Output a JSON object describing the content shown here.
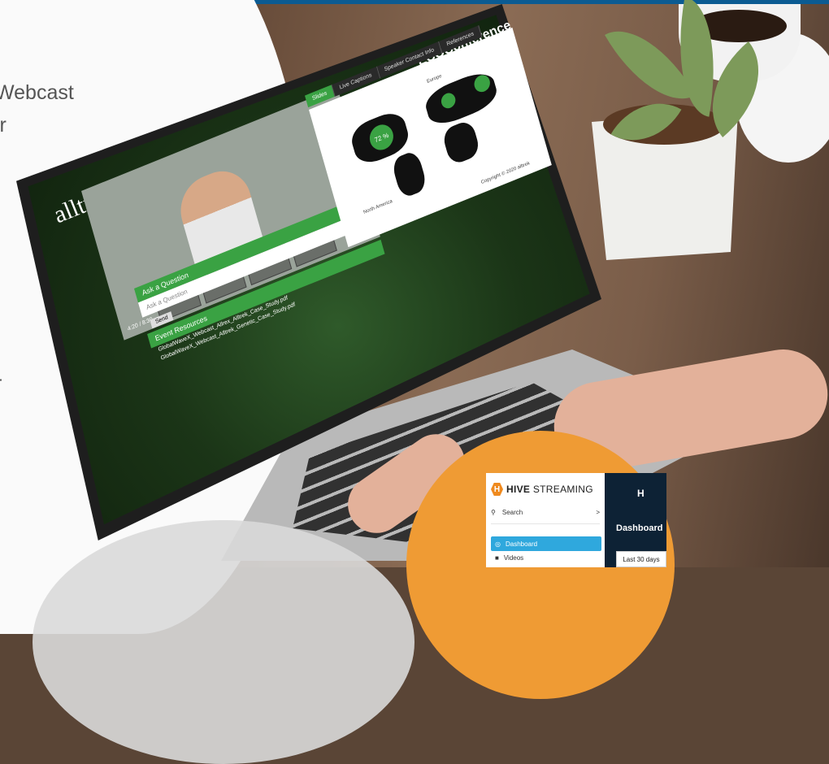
{
  "page": {
    "left_text": [
      "Webcast",
      "ir",
      "r"
    ]
  },
  "conference": {
    "logo": "ECOConference",
    "company_logo": "alltrek",
    "tabs": [
      "Slides",
      "Live Captions",
      "Speaker Contact Info",
      "References"
    ],
    "video_controls": "4:20 / 8:30",
    "qa_title": "Ask a Question",
    "qa_placeholder": "Ask a Question",
    "qa_send": "Send",
    "resources_title": "Event Resources",
    "resources": [
      "GlobalWaveX_Webcast_Allrex_Alltrek_Case_Study.pdf",
      "GlobalWaveX_Webcast_Alltrek_Genetic_Case_Study.pdf"
    ],
    "map_labels": {
      "region_na": "North America",
      "region_eu": "Europe"
    },
    "map_values": [
      "72 %"
    ],
    "copyright": "Copyright © 2020 alltrek",
    "colors": {
      "accent": "#3aa243"
    }
  },
  "hive": {
    "brand_strong": "HIVE",
    "brand_light": "STREAMING",
    "logo_letter": "H",
    "search_label": "Search",
    "search_chevron": ">",
    "nav": [
      {
        "label": "Dashboard",
        "icon": "dashboard-icon",
        "active": true
      },
      {
        "label": "Videos",
        "icon": "video-camera-icon",
        "active": false
      }
    ],
    "main_heading": "H",
    "main_title": "Dashboard",
    "date_range": "Last 30 days",
    "colors": {
      "brand": "#ef8a1f",
      "active": "#2fa8dd",
      "main_bg": "#0d2235"
    }
  }
}
